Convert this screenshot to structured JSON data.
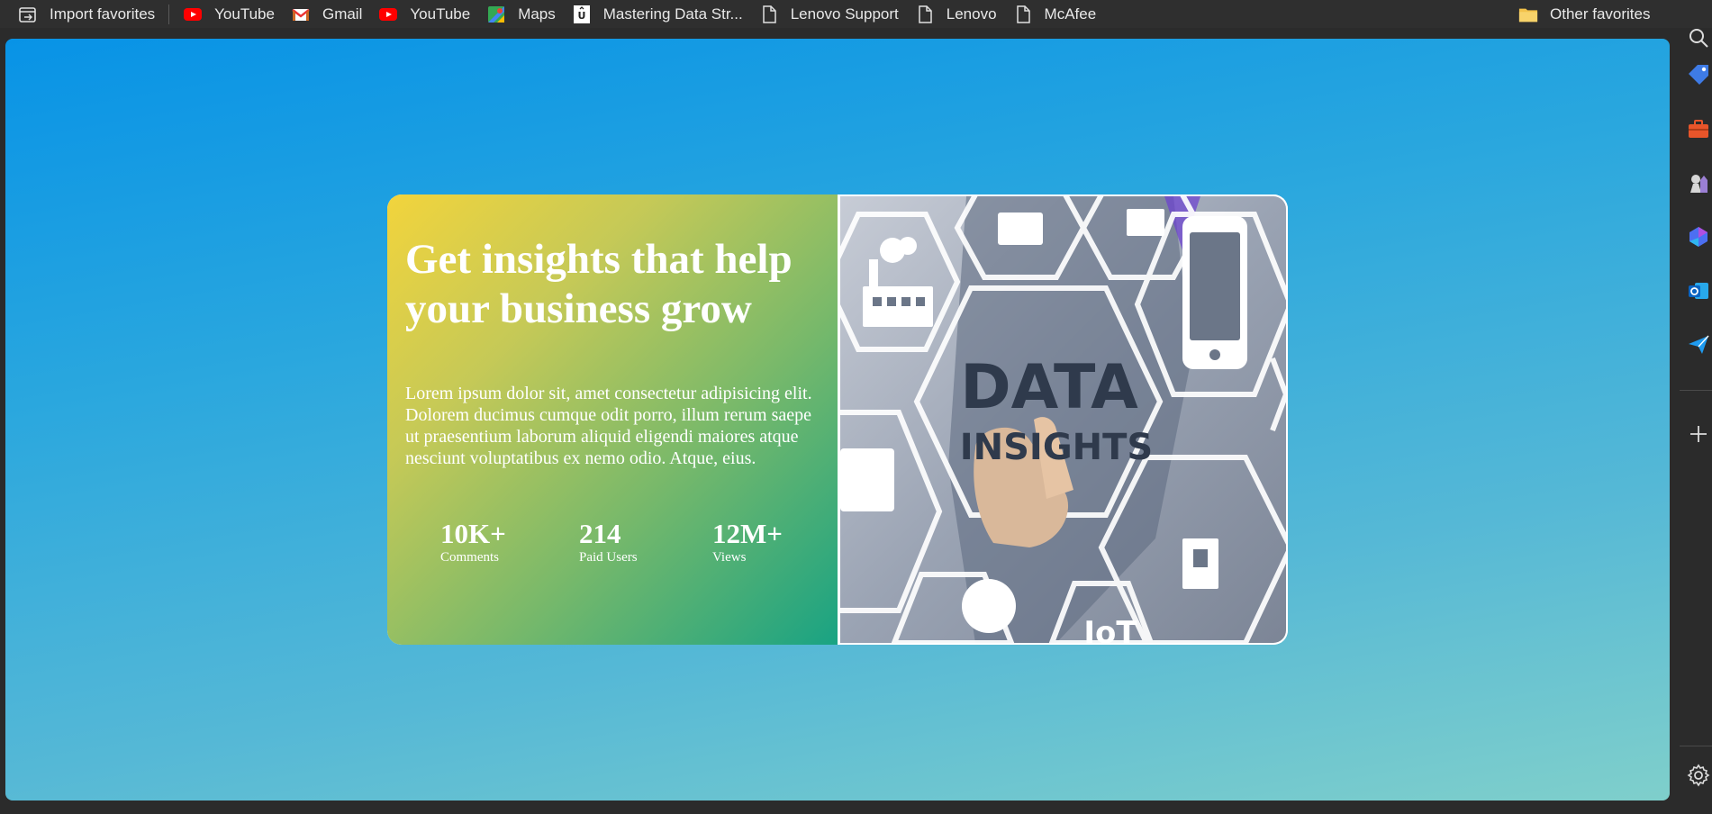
{
  "favorites": {
    "left": [
      {
        "label": "Import favorites",
        "icon": "import-icon"
      },
      {
        "label": "YouTube",
        "icon": "youtube-icon"
      },
      {
        "label": "Gmail",
        "icon": "gmail-icon"
      },
      {
        "label": "YouTube",
        "icon": "youtube-icon"
      },
      {
        "label": "Maps",
        "icon": "maps-icon"
      },
      {
        "label": "Mastering Data Str...",
        "icon": "bookmark-site-icon"
      },
      {
        "label": "Lenovo Support",
        "icon": "page-icon"
      },
      {
        "label": "Lenovo",
        "icon": "page-icon"
      },
      {
        "label": "McAfee",
        "icon": "page-icon"
      }
    ],
    "other": {
      "label": "Other favorites",
      "icon": "folder-icon"
    }
  },
  "card": {
    "headline": "Get insights that help your business grow",
    "description": "Lorem ipsum dolor sit, amet consectetur adipisicing elit. Dolorem ducimus cumque odit porro, illum rerum saepe ut praesentium laborum aliquid eligendi maiores atque nesciunt voluptatibus ex nemo odio. Atque, eius.",
    "stats": [
      {
        "value": "10K+",
        "label": "Comments"
      },
      {
        "value": "214",
        "label": "Paid Users"
      },
      {
        "value": "12M+",
        "label": "Views"
      }
    ],
    "image": {
      "text_line1": "DATA",
      "text_line2": "INSIGHTS",
      "text_line3": "IoT"
    }
  },
  "sidebar": {
    "icons": [
      "search-icon",
      "tag-icon",
      "toolbox-icon",
      "games-icon",
      "copilot-icon",
      "outlook-icon",
      "send-icon",
      "add-icon",
      "settings-icon"
    ]
  },
  "colors": {
    "accent_gradient_start": "#f2d43c",
    "accent_gradient_end": "#19a383",
    "page_gradient_start": "#0893e6",
    "page_gradient_end": "#7fcfcb"
  }
}
